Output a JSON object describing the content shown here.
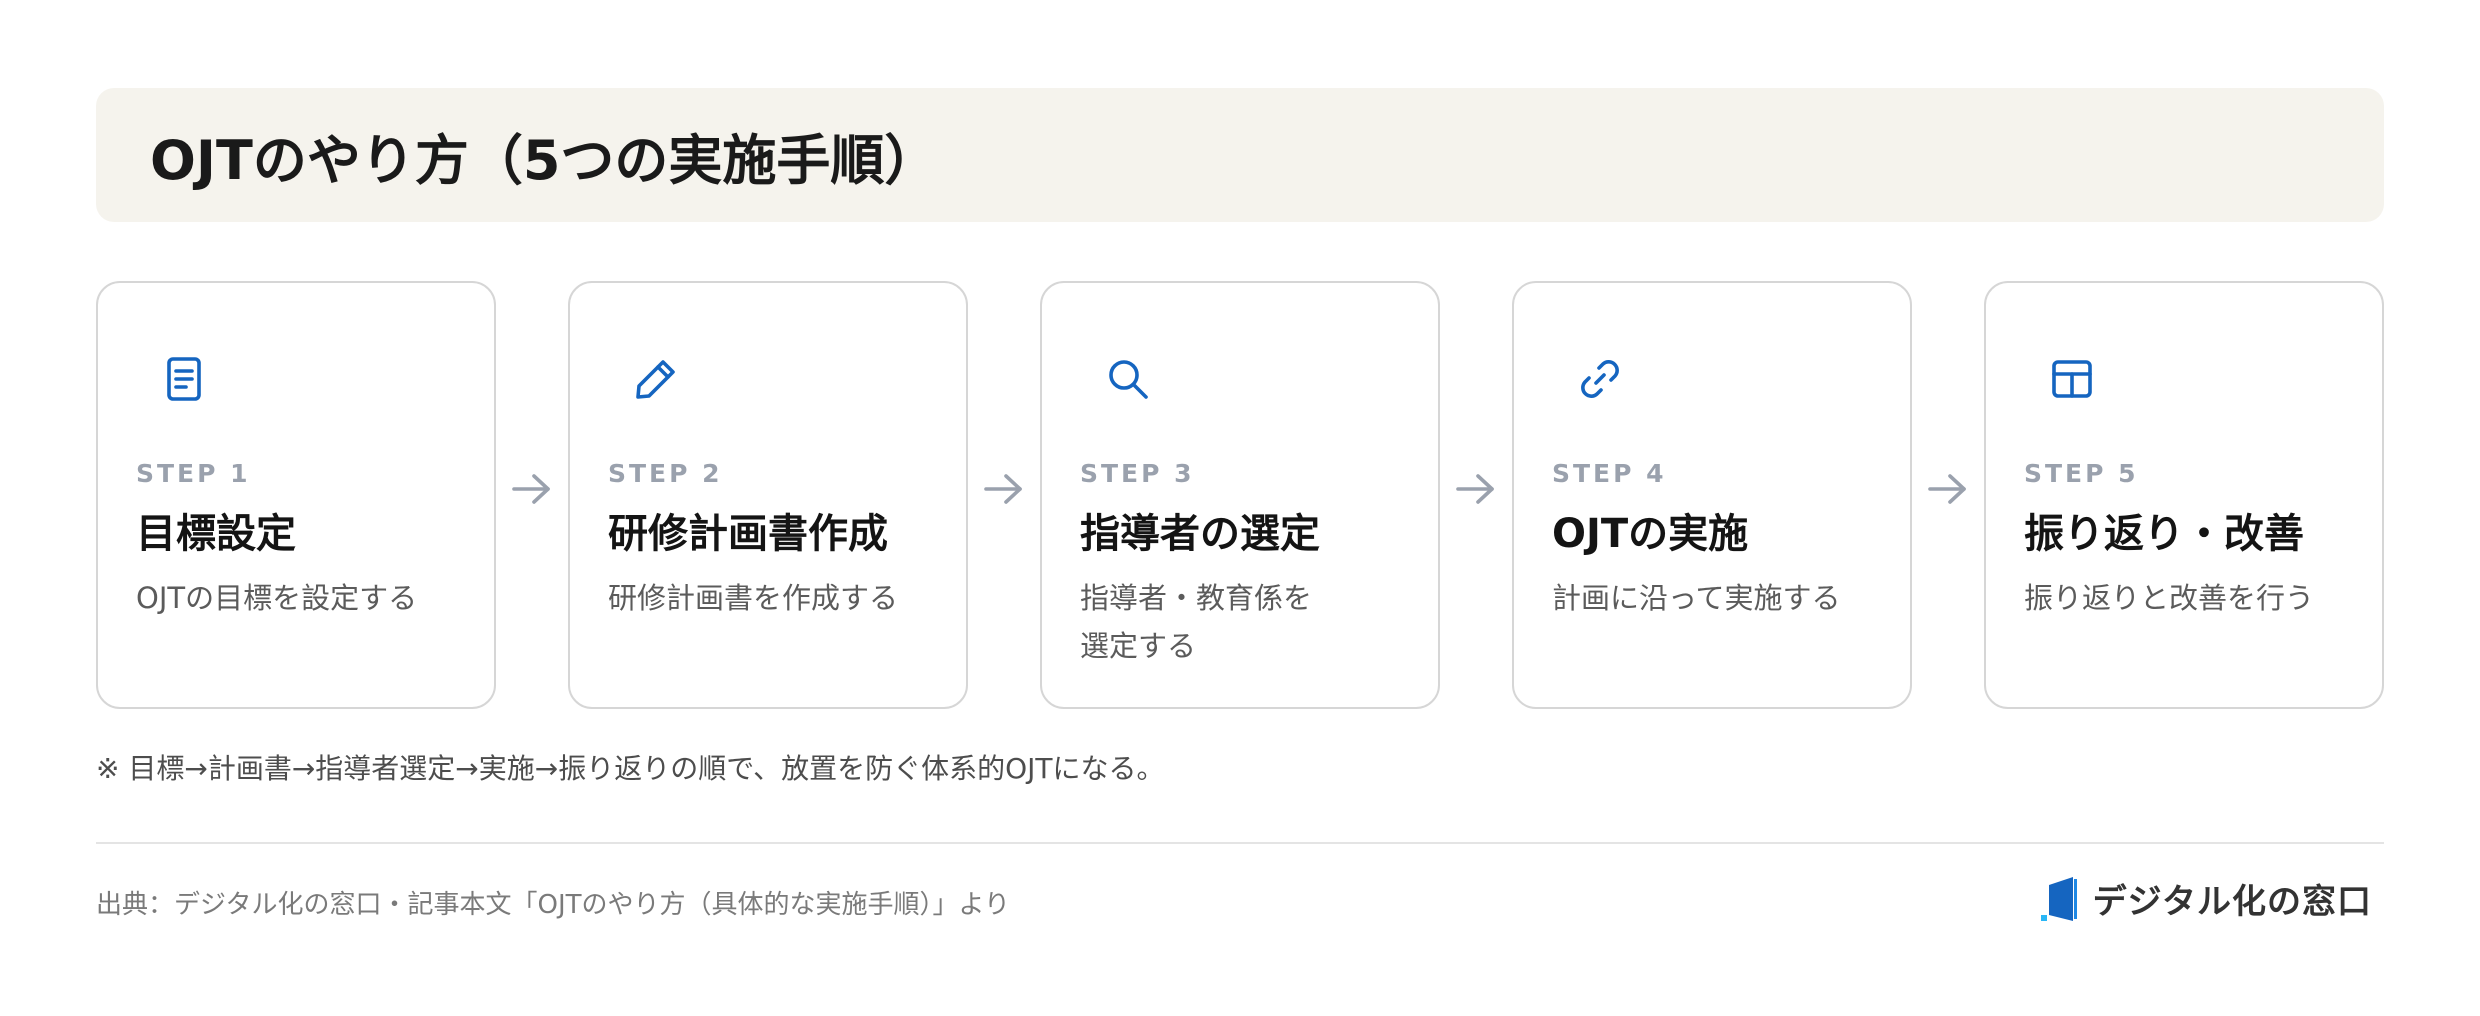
{
  "header": {
    "title": "OJTのやり方（5つの実施手順）"
  },
  "steps": [
    {
      "icon": "document-icon",
      "label": "STEP 1",
      "title": "目標設定",
      "desc": "OJTの目標を設定する"
    },
    {
      "icon": "pencil-icon",
      "label": "STEP 2",
      "title": "研修計画書作成",
      "desc": "研修計画書を作成する"
    },
    {
      "icon": "search-icon",
      "label": "STEP 3",
      "title": "指導者の選定",
      "desc": "指導者・教育係を選定する"
    },
    {
      "icon": "link-icon",
      "label": "STEP 4",
      "title": "OJTの実施",
      "desc": "計画に沿って実施する"
    },
    {
      "icon": "table-icon",
      "label": "STEP 5",
      "title": "振り返り・改善",
      "desc": "振り返りと改善を行う"
    }
  ],
  "footnote": "※ 目標→計画書→指導者選定→実施→振り返りの順で、放置を防ぐ体系的OJTになる。",
  "footer": {
    "source": "出典：デジタル化の窓口・記事本文「OJTのやり方（具体的な実施手順）」より",
    "brand": "デジタル化の窓口"
  },
  "colors": {
    "accent": "#1565c0",
    "banner": "#f5f3ed",
    "muted": "#9aa1ad"
  }
}
